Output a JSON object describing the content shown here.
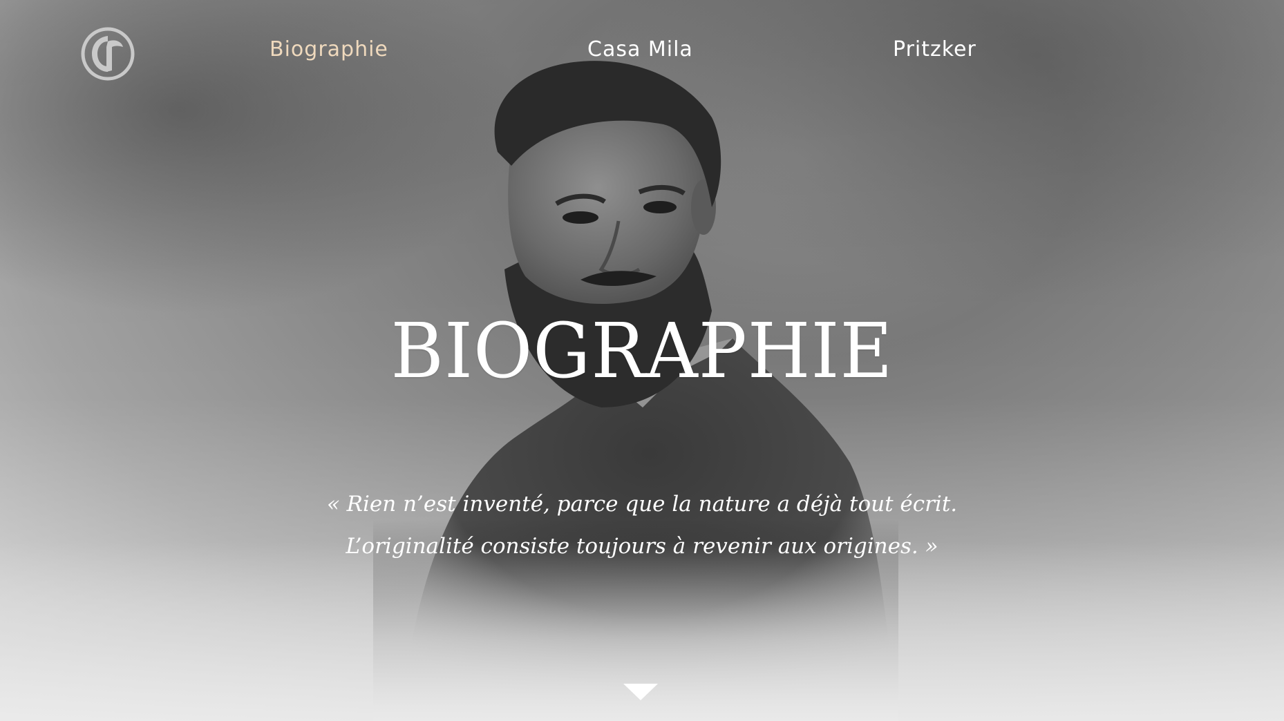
{
  "nav": {
    "logo_icon": "gaudi-monogram-icon",
    "links": [
      {
        "label": "Biographie",
        "active": true
      },
      {
        "label": "Casa Mila",
        "active": false
      },
      {
        "label": "Pritzker",
        "active": false
      }
    ],
    "active_color": "#efd9bd",
    "link_color": "#ffffff"
  },
  "hero": {
    "title": "BIOGRAPHIE",
    "quote_line1": "« Rien n’est inventé, parce que la nature a déjà tout écrit.",
    "quote_line2": "L’originalité consiste toujours à revenir aux origines. »",
    "scroll_icon": "triangle-down-icon"
  }
}
